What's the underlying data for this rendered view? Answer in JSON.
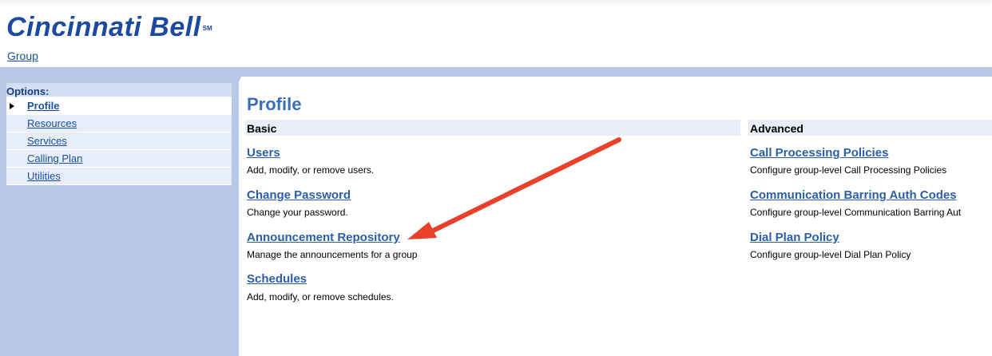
{
  "header": {
    "logo_text": "Cincinnati Bell",
    "logo_mark": "SM",
    "breadcrumb": "Group"
  },
  "sidebar": {
    "title": "Options:",
    "items": [
      {
        "label": "Profile",
        "active": true
      },
      {
        "label": "Resources",
        "active": false
      },
      {
        "label": "Services",
        "active": false
      },
      {
        "label": "Calling Plan",
        "active": false
      },
      {
        "label": "Utilities",
        "active": false
      }
    ]
  },
  "main": {
    "title": "Profile",
    "basic": {
      "header": "Basic",
      "items": [
        {
          "label": "Users",
          "desc": "Add, modify, or remove users."
        },
        {
          "label": "Change Password",
          "desc": "Change your password."
        },
        {
          "label": "Announcement Repository",
          "desc": "Manage the announcements for a group"
        },
        {
          "label": "Schedules",
          "desc": "Add, modify, or remove schedules."
        }
      ]
    },
    "advanced": {
      "header": "Advanced",
      "items": [
        {
          "label": "Call Processing Policies",
          "desc": "Configure group-level Call Processing Policies"
        },
        {
          "label": "Communication Barring Auth Codes",
          "desc": "Configure group-level Communication Barring Aut"
        },
        {
          "label": "Dial Plan Policy",
          "desc": "Configure group-level Dial Plan Policy"
        }
      ]
    }
  },
  "annotation": {
    "type": "arrow",
    "color": "#e8402a",
    "target": "Announcement Repository"
  },
  "colors": {
    "brand": "#1b4aa0",
    "link": "#2a5fa8",
    "sidebar_bg": "#b8c9e8",
    "arrow": "#e8402a"
  }
}
